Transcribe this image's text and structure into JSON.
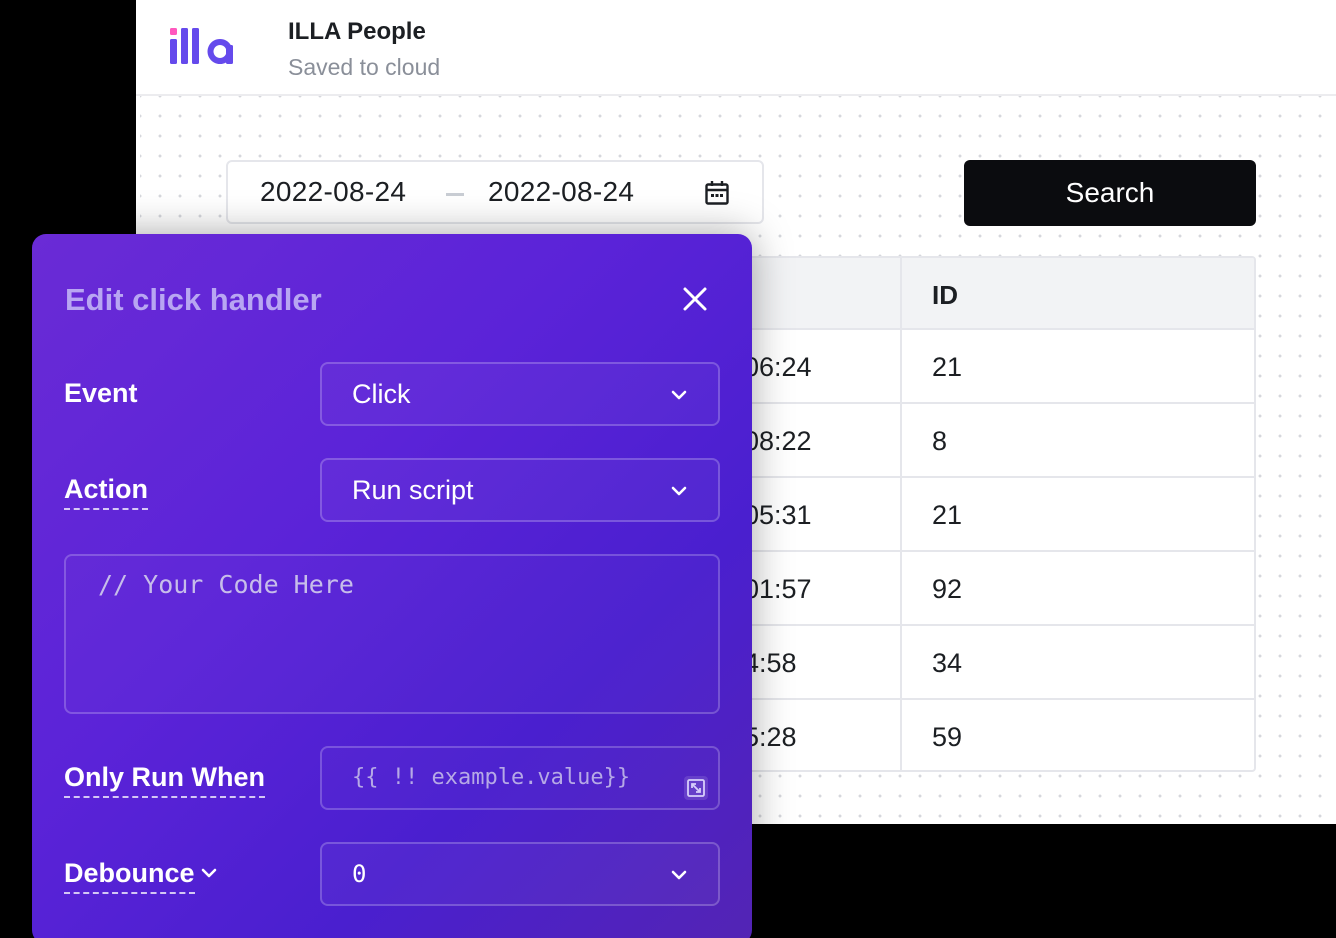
{
  "app": {
    "title": "ILLA People",
    "save_status": "Saved to cloud",
    "logo_text": "illa"
  },
  "toolbar": {
    "date_start": "2022-08-24",
    "date_end": "2022-08-24",
    "search_label": "Search"
  },
  "table": {
    "id_header": "ID",
    "rows": [
      {
        "time": "06:24",
        "id": "21"
      },
      {
        "time": "08:22",
        "id": "8"
      },
      {
        "time": "05:31",
        "id": "21"
      },
      {
        "time": "01:57",
        "id": "92"
      },
      {
        "time": "4:58",
        "id": "34"
      },
      {
        "time": "5:28",
        "id": "59"
      }
    ]
  },
  "modal": {
    "title": "Edit click handler",
    "event_label": "Event",
    "event_value": "Click",
    "action_label": "Action",
    "action_value": "Run script",
    "code_placeholder": "// Your Code Here",
    "only_run_when_label": "Only Run When",
    "only_run_when_placeholder": "{{ !! example.value}}",
    "debounce_label": "Debounce",
    "debounce_value": "0"
  },
  "colors": {
    "brand_purple": "#654aec",
    "brand_pink": "#ff58be",
    "search_button": "#0b0c0f",
    "modal_gradient_start": "#6a2bd6",
    "modal_gradient_end": "#4a1fcf"
  },
  "icons": [
    "calendar-icon",
    "close-icon",
    "chevron-down-icon",
    "expand-icon"
  ]
}
